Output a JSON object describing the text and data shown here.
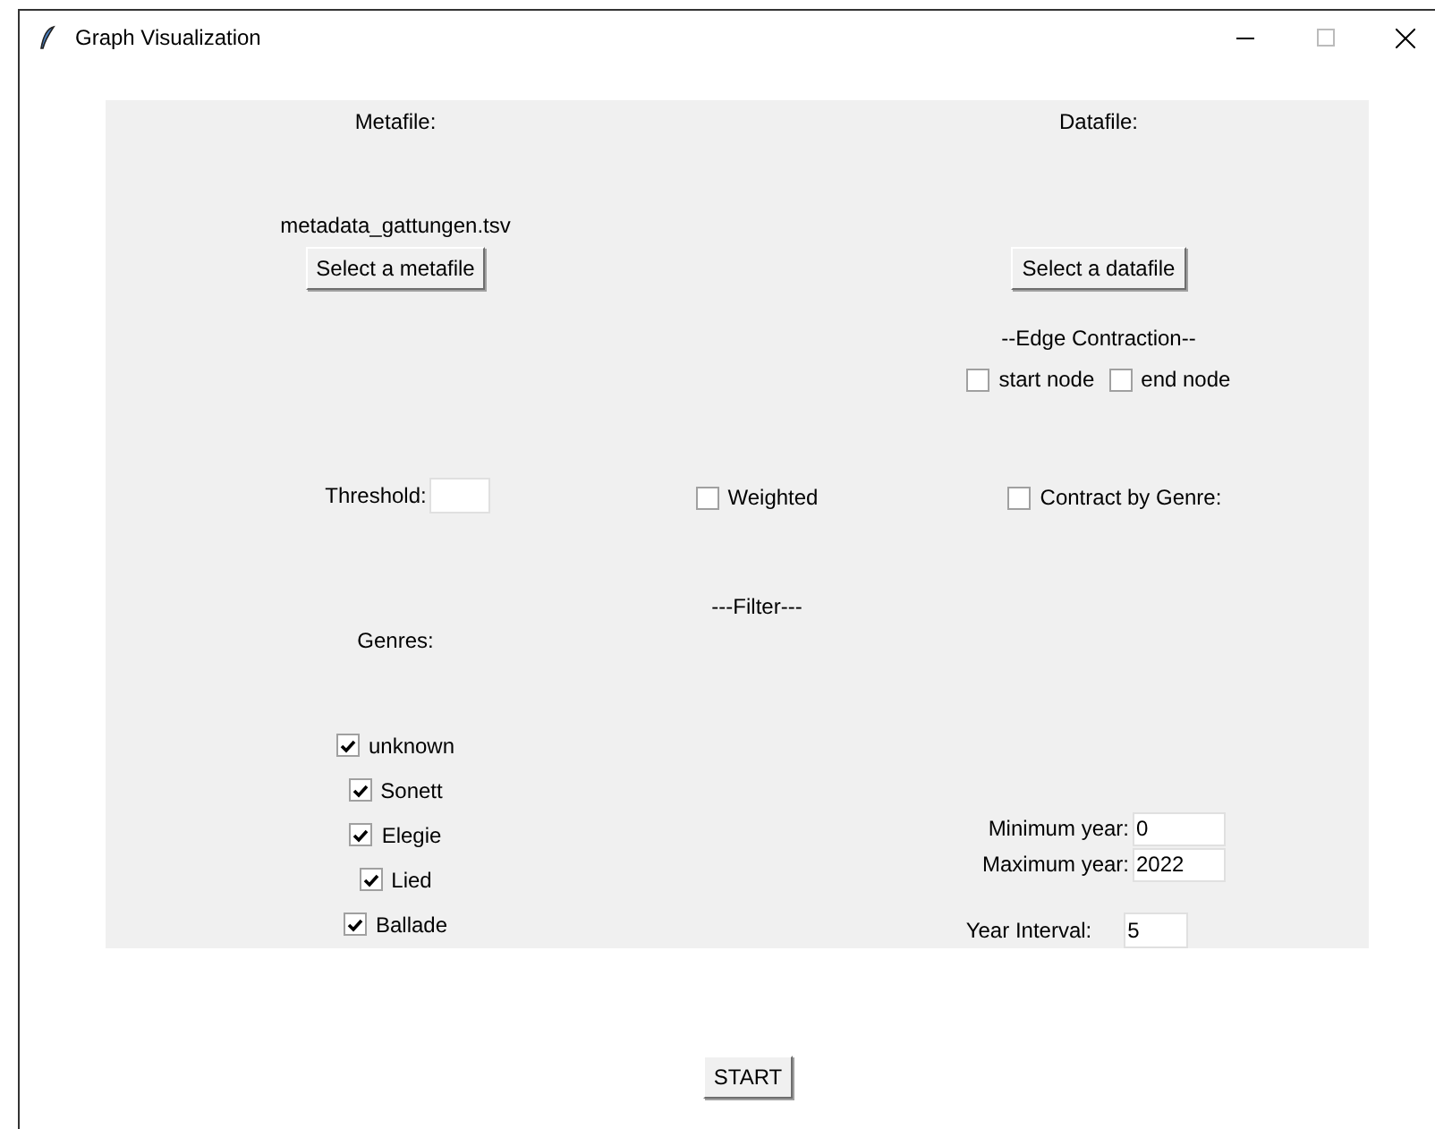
{
  "window": {
    "title": "Graph Visualization"
  },
  "metafile": {
    "label": "Metafile:",
    "filename": "metadata_gattungen.tsv",
    "button": "Select a metafile"
  },
  "datafile": {
    "label": "Datafile:",
    "button": "Select a datafile"
  },
  "edge_contraction": {
    "title": "--Edge Contraction--",
    "options": [
      {
        "label": "start node",
        "checked": false
      },
      {
        "label": "end node",
        "checked": false
      }
    ]
  },
  "threshold": {
    "label": "Threshold:"
  },
  "weighted": {
    "label": "Weighted",
    "checked": false
  },
  "contract_by_genre": {
    "label": "Contract by Genre:",
    "checked": false
  },
  "filter": {
    "title": "---Filter---"
  },
  "genres": {
    "label": "Genres:",
    "items": [
      {
        "label": "unknown",
        "checked": true
      },
      {
        "label": "Sonett",
        "checked": true
      },
      {
        "label": "Elegie",
        "checked": true
      },
      {
        "label": "Lied",
        "checked": true
      },
      {
        "label": "Ballade",
        "checked": true
      }
    ]
  },
  "years": [
    {
      "label": "Minimum year:",
      "value": "0"
    },
    {
      "label": "Maximum year:",
      "value": "2022"
    }
  ],
  "interval": {
    "label": "Year Interval:",
    "value": "5"
  },
  "start_button": "START"
}
